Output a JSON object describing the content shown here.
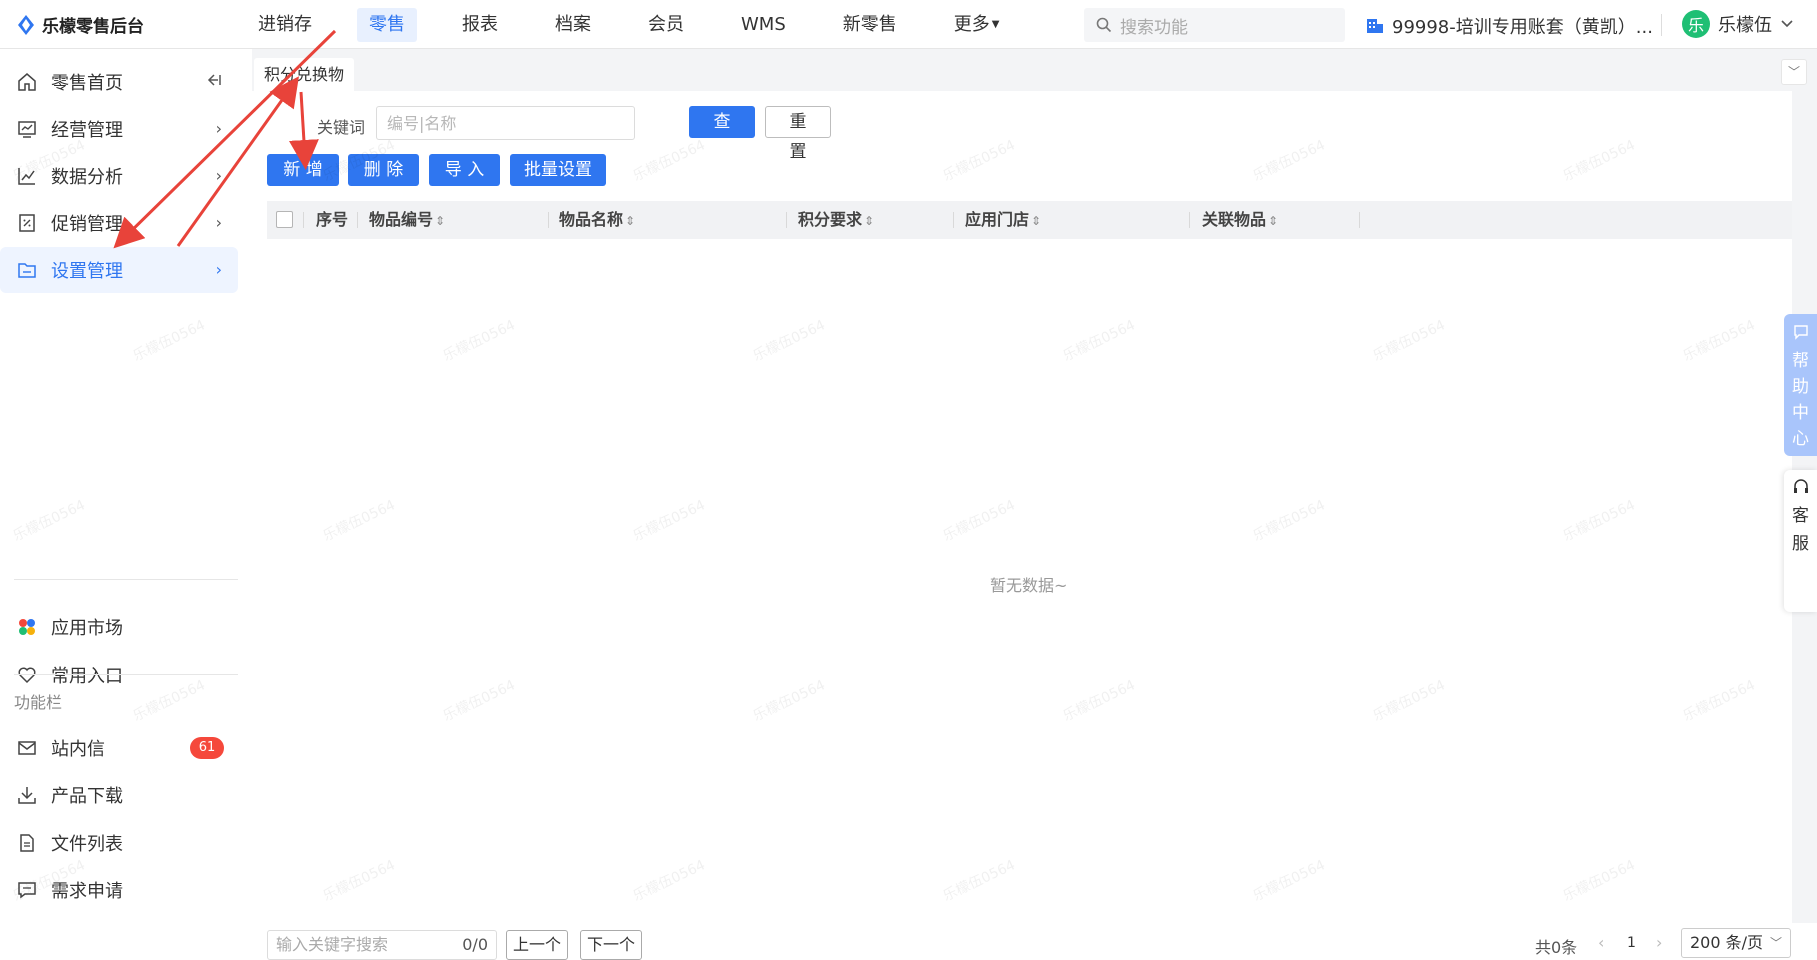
{
  "app": {
    "title": "乐檬零售后台"
  },
  "nav": {
    "items": [
      {
        "label": "进销存"
      },
      {
        "label": "零售"
      },
      {
        "label": "报表"
      },
      {
        "label": "档案"
      },
      {
        "label": "会员"
      },
      {
        "label": "WMS"
      },
      {
        "label": "新零售"
      },
      {
        "label": "更多"
      }
    ],
    "active": "零售"
  },
  "search": {
    "placeholder": "搜索功能"
  },
  "account": {
    "label": "99998-培训专用账套（黄凯）..."
  },
  "user": {
    "avatar_text": "乐",
    "name": "乐檬伍"
  },
  "sidebar": {
    "items": [
      {
        "label": "零售首页"
      },
      {
        "label": "经营管理"
      },
      {
        "label": "数据分析"
      },
      {
        "label": "促销管理"
      },
      {
        "label": "设置管理"
      }
    ],
    "bottom": [
      {
        "label": "应用市场"
      },
      {
        "label": "常用入口"
      }
    ],
    "section_label": "功能栏",
    "functions": [
      {
        "label": "站内信",
        "badge": "61"
      },
      {
        "label": "产品下载"
      },
      {
        "label": "文件列表"
      },
      {
        "label": "需求申请"
      }
    ]
  },
  "tab": {
    "label": "积分兑换物"
  },
  "filter": {
    "keyword_label": "关键词",
    "keyword_placeholder": "编号|名称",
    "query_label": "查 询",
    "reset_label": "重 置"
  },
  "toolbar": {
    "add_label": "新 增",
    "delete_label": "删 除",
    "import_label": "导 入",
    "batch_label": "批量设置"
  },
  "table": {
    "columns": [
      {
        "label": "序号",
        "sortable": false
      },
      {
        "label": "物品编号",
        "sortable": true
      },
      {
        "label": "物品名称",
        "sortable": true
      },
      {
        "label": "积分要求",
        "sortable": true
      },
      {
        "label": "应用门店",
        "sortable": true
      },
      {
        "label": "关联物品",
        "sortable": true
      }
    ],
    "empty_text": "暂无数据~"
  },
  "pager": {
    "search_placeholder": "输入关键字搜索",
    "search_count": "0/0",
    "prev_label": "上一个",
    "next_label": "下一个",
    "total_text": "共0条",
    "current_page": "1",
    "page_size": "200 条/页"
  },
  "float": {
    "help_label": "帮助中心",
    "kefu_label": "客服"
  },
  "watermark": "乐檬伍0564",
  "colors": {
    "accent": "#2f76f0",
    "badge": "#f5483b",
    "annotation": "#e8433a"
  }
}
